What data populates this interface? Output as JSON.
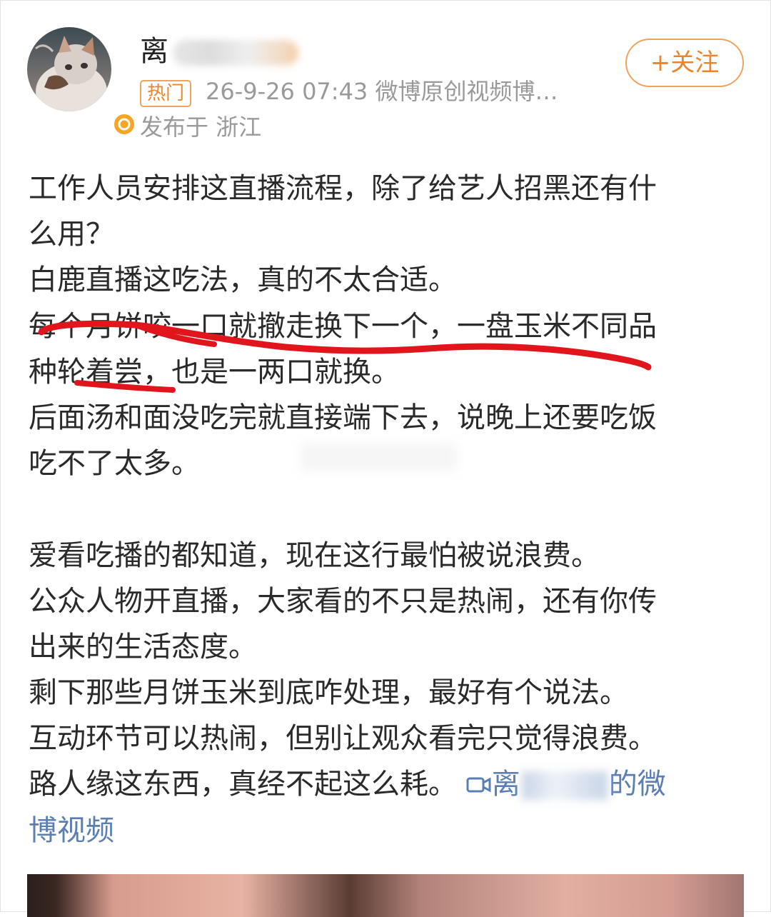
{
  "header": {
    "username_visible": "离",
    "hot_badge": "热门",
    "timestamp_source": "26-9-26 07:43  微博原创视频博…",
    "location": "发布于 浙江",
    "follow_button": "+关注"
  },
  "icons": {
    "avatar": "cat-avatar",
    "verified": "verified-badge-icon",
    "video": "video-camera-icon"
  },
  "colors": {
    "accent_orange": "#e9862d",
    "link_blue": "#5b7fb3",
    "annotation_red": "#e0161c"
  },
  "post": {
    "lines": [
      "工作人员安排这直播流程，除了给艺人招黑还有什",
      "么用？",
      "白鹿直播这吃法，真的不太合适。",
      "每个月饼咬一口就撤走换下一个，一盘玉米不同品",
      "种轮着尝，也是一两口就换。",
      "后面汤和面没吃完就直接端下去，说晚上还要吃饭",
      "吃不了太多。",
      "",
      "爱看吃播的都知道，现在这行最怕被说浪费。",
      "公众人物开直播，大家看的不只是热闹，还有你传",
      "出来的生活态度。",
      "剩下那些月饼玉米到底咋处理，最好有个说法。",
      "互动环节可以热闹，但别让观众看完只觉得浪费。",
      "路人缘这东西，真经不起这么耗。"
    ],
    "video_link_start": "离",
    "video_link_end": "的微",
    "video_link_line2": "博视频"
  }
}
